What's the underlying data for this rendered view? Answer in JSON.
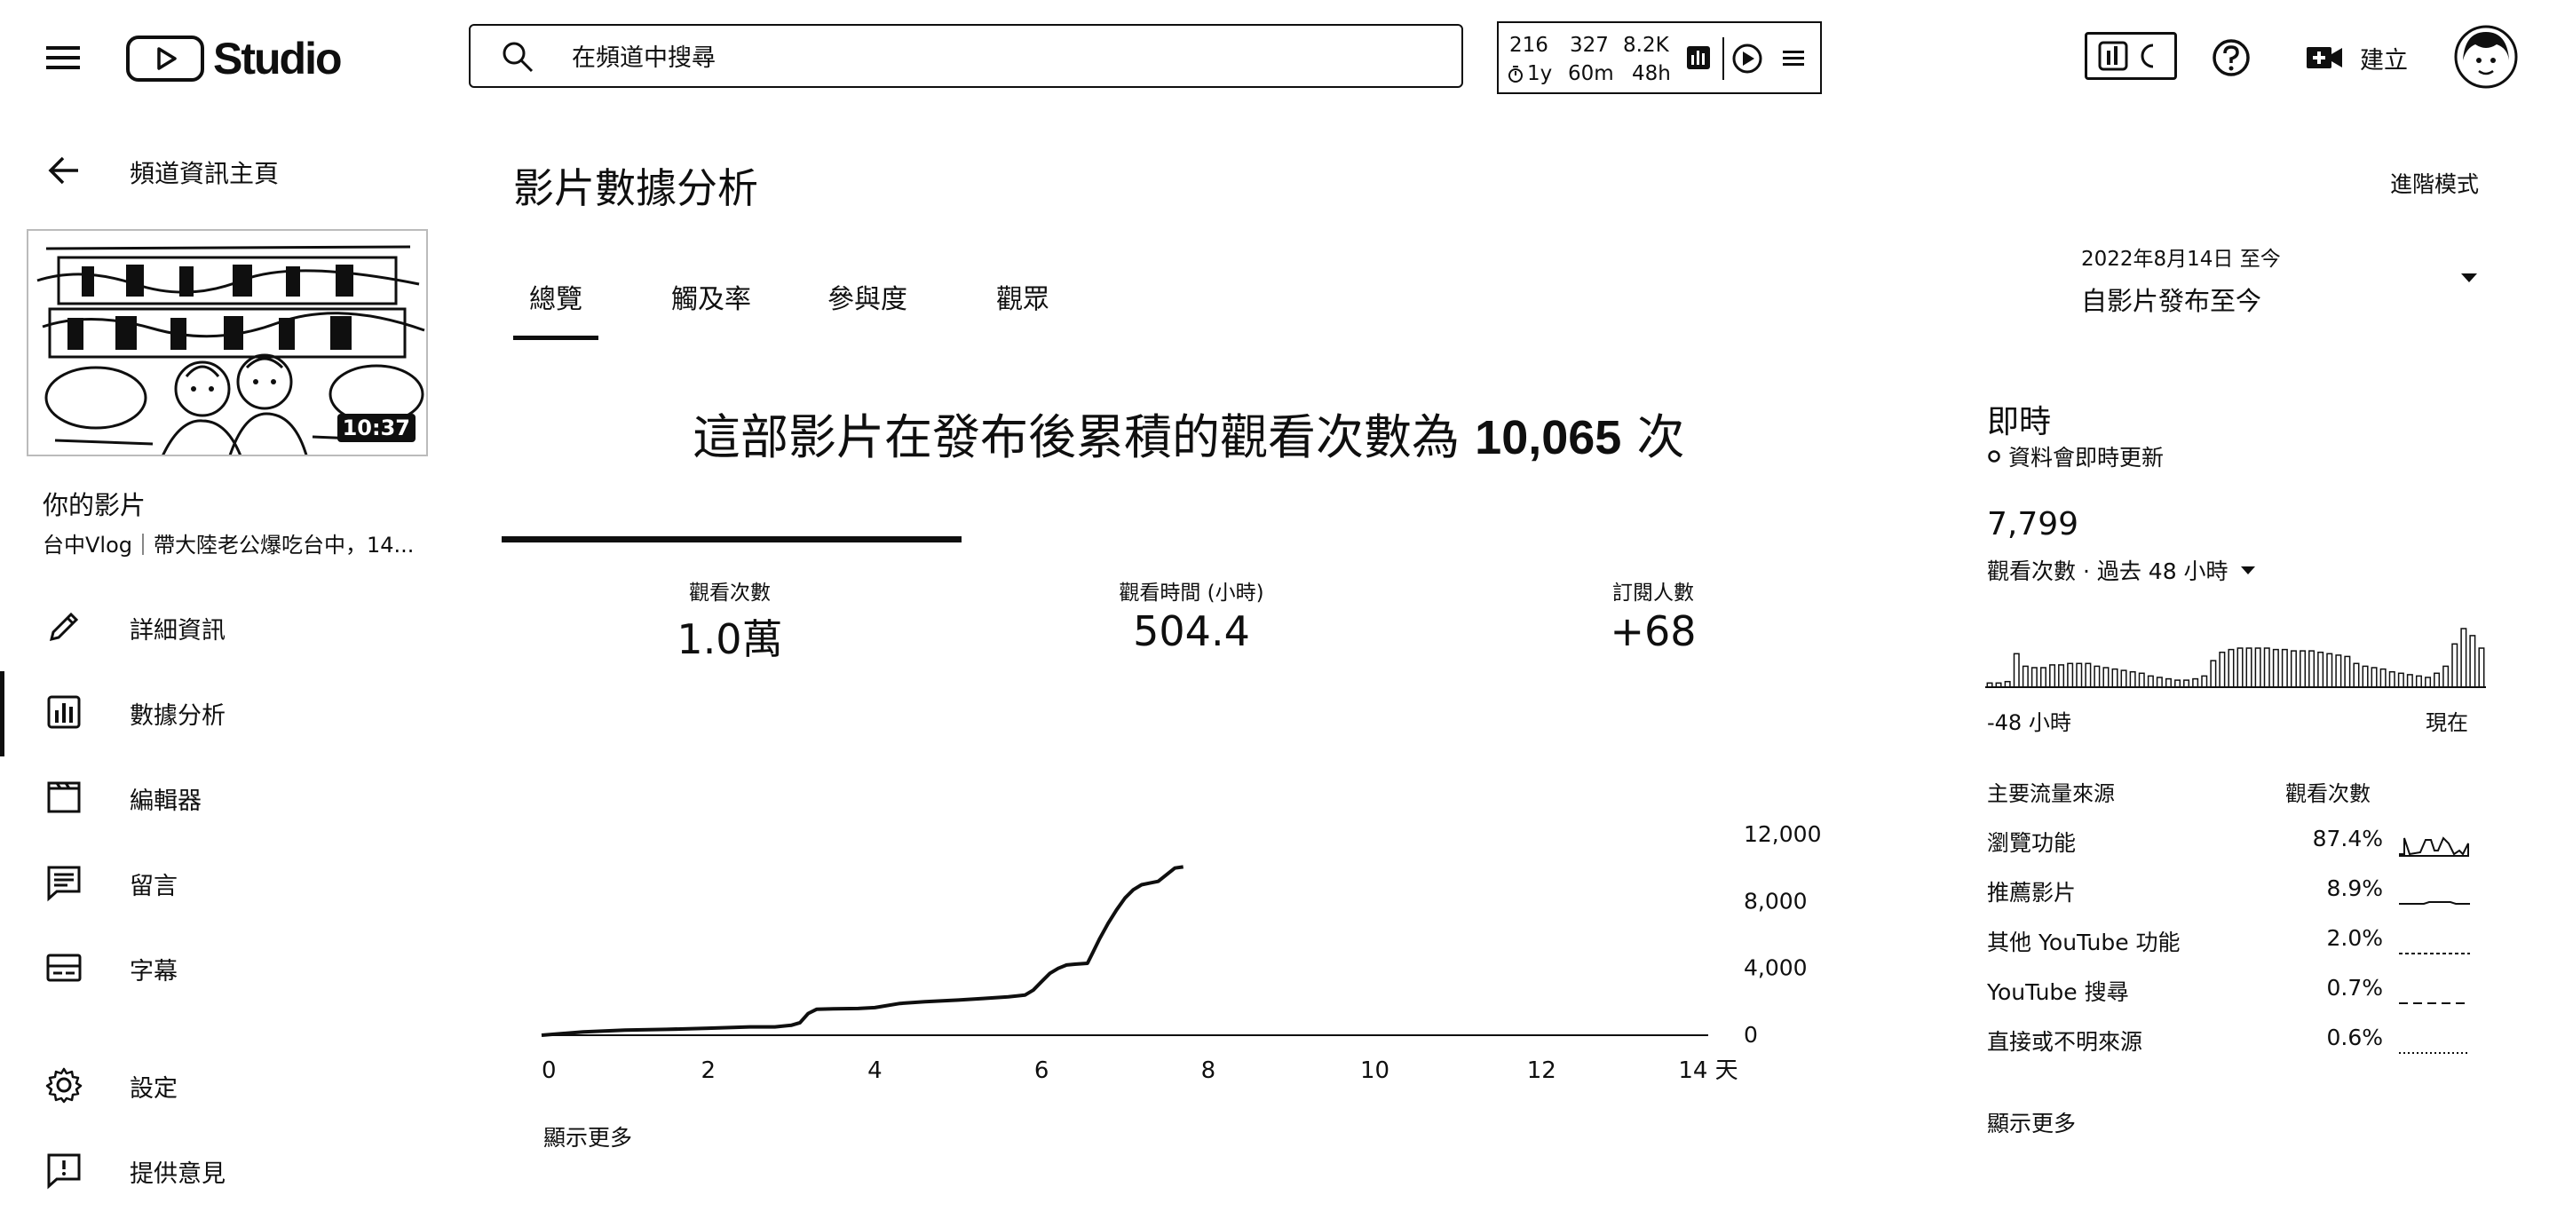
{
  "app": {
    "logo_text": "Studio",
    "search_placeholder": "在頻道中搜尋",
    "create_label": "建立"
  },
  "stats_widget": {
    "top": [
      "216",
      "327",
      "8.2K"
    ],
    "bottom": [
      "1y",
      "60m",
      "48h"
    ]
  },
  "sidebar": {
    "back_label": "頻道資訊主頁",
    "thumbnail_duration": "10:37",
    "your_video_label": "你的影片",
    "video_title": "台中Vlog｜帶大陸老公爆吃台中，14...",
    "items": [
      {
        "label": "詳細資訊",
        "icon": "pencil-icon"
      },
      {
        "label": "數據分析",
        "icon": "analytics-icon"
      },
      {
        "label": "編輯器",
        "icon": "clapperboard-icon"
      },
      {
        "label": "留言",
        "icon": "comment-icon"
      },
      {
        "label": "字幕",
        "icon": "subtitles-icon"
      },
      {
        "label": "設定",
        "icon": "gear-icon"
      },
      {
        "label": "提供意見",
        "icon": "feedback-icon"
      }
    ]
  },
  "main": {
    "title": "影片數據分析",
    "tabs": [
      "總覽",
      "觸及率",
      "參與度",
      "觀眾"
    ],
    "active_tab": 0,
    "headline_prefix": "這部影片在發布後累積的觀看次數為 ",
    "headline_number": "10,065",
    "headline_suffix": " 次",
    "metrics": [
      {
        "label": "觀看次數",
        "value": "1.0萬"
      },
      {
        "label": "觀看時間 (小時)",
        "value": "504.4"
      },
      {
        "label": "訂閱人數",
        "value": "+68"
      }
    ],
    "show_more": "顯示更多"
  },
  "chart_data": {
    "type": "line",
    "title": "",
    "xlabel": "",
    "ylabel": "",
    "x_tick_labels": [
      "0",
      "2",
      "4",
      "6",
      "8",
      "10",
      "12",
      "14 天"
    ],
    "y_tick_labels": [
      "12,000",
      "8,000",
      "4,000",
      "0"
    ],
    "xlim": [
      0,
      14
    ],
    "ylim": [
      0,
      12000
    ],
    "series": [
      {
        "x": [
          0,
          0.5,
          1,
          1.5,
          2,
          2.5,
          2.8,
          3.0,
          3.1,
          3.2,
          3.3,
          3.5,
          3.8,
          4.0,
          4.3,
          4.6,
          5.0,
          5.3,
          5.6,
          5.8,
          5.9,
          6.0,
          6.1,
          6.2,
          6.3,
          6.4,
          6.55,
          6.6,
          6.7,
          6.8,
          6.9,
          7.0,
          7.1,
          7.2,
          7.3,
          7.4,
          7.5,
          7.6,
          7.7
        ],
        "y": [
          0,
          200,
          300,
          350,
          420,
          500,
          500,
          600,
          750,
          1300,
          1550,
          1580,
          1600,
          1650,
          1900,
          2000,
          2100,
          2200,
          2300,
          2400,
          2700,
          3200,
          3700,
          4000,
          4200,
          4250,
          4300,
          4800,
          5800,
          6700,
          7500,
          8200,
          8700,
          9000,
          9100,
          9200,
          9600,
          10000,
          10065
        ]
      }
    ],
    "grid": false,
    "legend": "none"
  },
  "right_panel": {
    "advanced_mode": "進階模式",
    "date_line1": "2022年8月14日 至今",
    "date_line2": "自影片發布至今",
    "realtime_title": "即時",
    "realtime_sub": "資料會即時更新",
    "realtime_views": "7,799",
    "realtime_label": "觀看次數 · 過去 48 小時",
    "axis_left": "-48 小時",
    "axis_right": "現在",
    "realtime_bars": [
      3,
      3,
      4,
      24,
      15,
      14,
      14,
      16,
      16,
      17,
      17,
      17,
      15,
      14,
      13,
      12,
      11,
      10,
      8,
      7,
      6,
      5,
      5,
      6,
      8,
      19,
      25,
      27,
      28,
      28,
      28,
      28,
      27,
      27,
      26,
      26,
      26,
      25,
      24,
      23,
      22,
      17,
      15,
      14,
      13,
      11,
      10,
      9,
      8,
      7,
      10,
      15,
      31,
      42,
      37,
      28
    ],
    "sources_header": [
      "主要流量來源",
      "觀看次數"
    ],
    "sources": [
      {
        "name": "瀏覽功能",
        "pct": "87.4%",
        "pct_value": 87.4
      },
      {
        "name": "推薦影片",
        "pct": "8.9%",
        "pct_value": 8.9
      },
      {
        "name": "其他 YouTube 功能",
        "pct": "2.0%",
        "pct_value": 2.0
      },
      {
        "name": "YouTube 搜尋",
        "pct": "0.7%",
        "pct_value": 0.7
      },
      {
        "name": "直接或不明來源",
        "pct": "0.6%",
        "pct_value": 0.6
      }
    ],
    "show_more": "顯示更多"
  }
}
